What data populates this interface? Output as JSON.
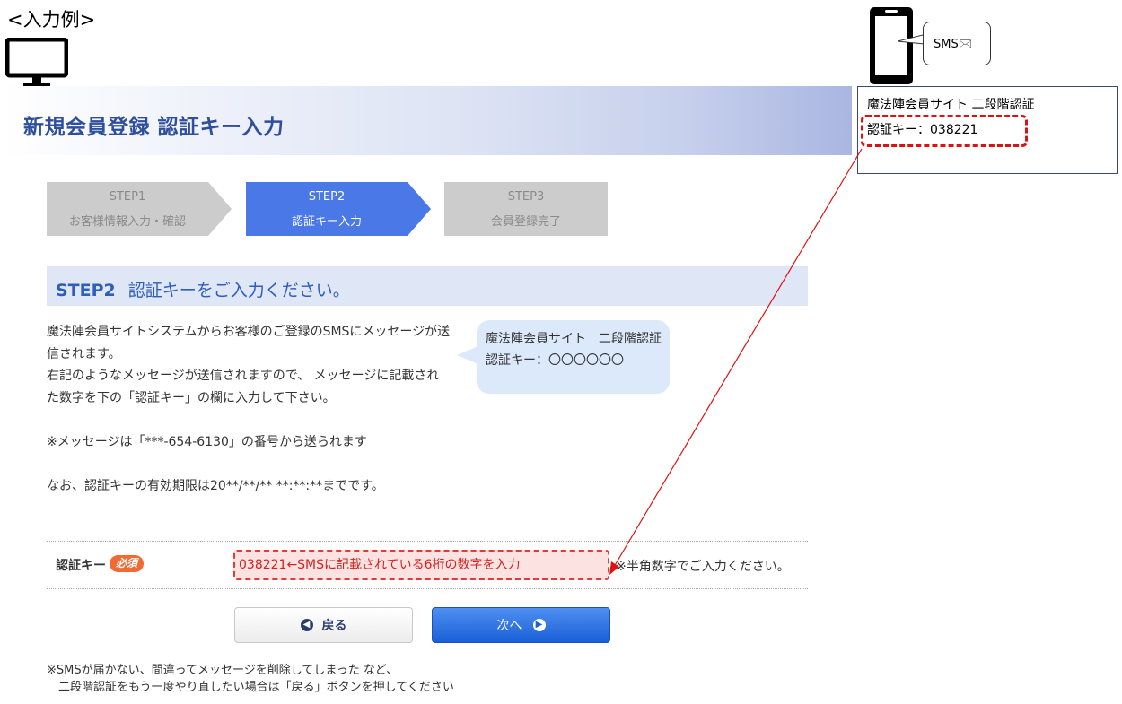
{
  "example_label": "<入力例>",
  "header": {
    "title": "新規会員登録 認証キー入力"
  },
  "steps": [
    {
      "name": "STEP1",
      "label": "お客様情報入力・確認",
      "state": "done"
    },
    {
      "name": "STEP2",
      "label": "認証キー入力",
      "state": "current"
    },
    {
      "name": "STEP3",
      "label": "会員登録完了",
      "state": "upcoming"
    }
  ],
  "section": {
    "step": "STEP2",
    "title": "認証キーをご入力ください。"
  },
  "body_lines": [
    "魔法陣会員サイトシステムからお客様のご登録のSMSにメッセージが送",
    "信されます。",
    "右記のようなメッセージが送信されますので、 メッセージに記載され",
    "た数字を下の「認証キー」の欄に入力して下さい。",
    "",
    "※メッセージは「***-654-6130」の番号から送られます",
    "",
    "なお、認証キーの有効期限は20**/**/** **:**:**までです。"
  ],
  "bubble": {
    "line1": "魔法陣会員サイト　二段階認証",
    "line2": "認証キー：〇〇〇〇〇〇"
  },
  "form": {
    "label": "認証キー",
    "required_badge": "必須",
    "input_value": "038221←SMSに記載されている6桁の数字を入力",
    "hint": "※半角数字でご入力ください。"
  },
  "buttons": {
    "back": "戻る",
    "next": "次へ"
  },
  "footer_lines": [
    "※SMSが届かない、間違ってメッセージを削除してしまった など、",
    "　二段階認証をもう一度やり直したい場合は「戻る」ボタンを押してください"
  ],
  "phone": {
    "sms_label": "SMS🖂",
    "message_line1": "魔法陣会員サイト 二段階認証",
    "message_line2": "認証キー：038221"
  },
  "colors": {
    "header_accent": "#2f4f9c",
    "step_active": "#4a78e6",
    "step_inactive": "#cccccc",
    "highlight_red": "#e01010",
    "next_button": "#1a5fd8",
    "required_badge": "#f06a34"
  },
  "icons": [
    "monitor-icon",
    "smartphone-icon",
    "mail-icon",
    "arrow-left-circle-icon",
    "arrow-right-circle-icon"
  ]
}
